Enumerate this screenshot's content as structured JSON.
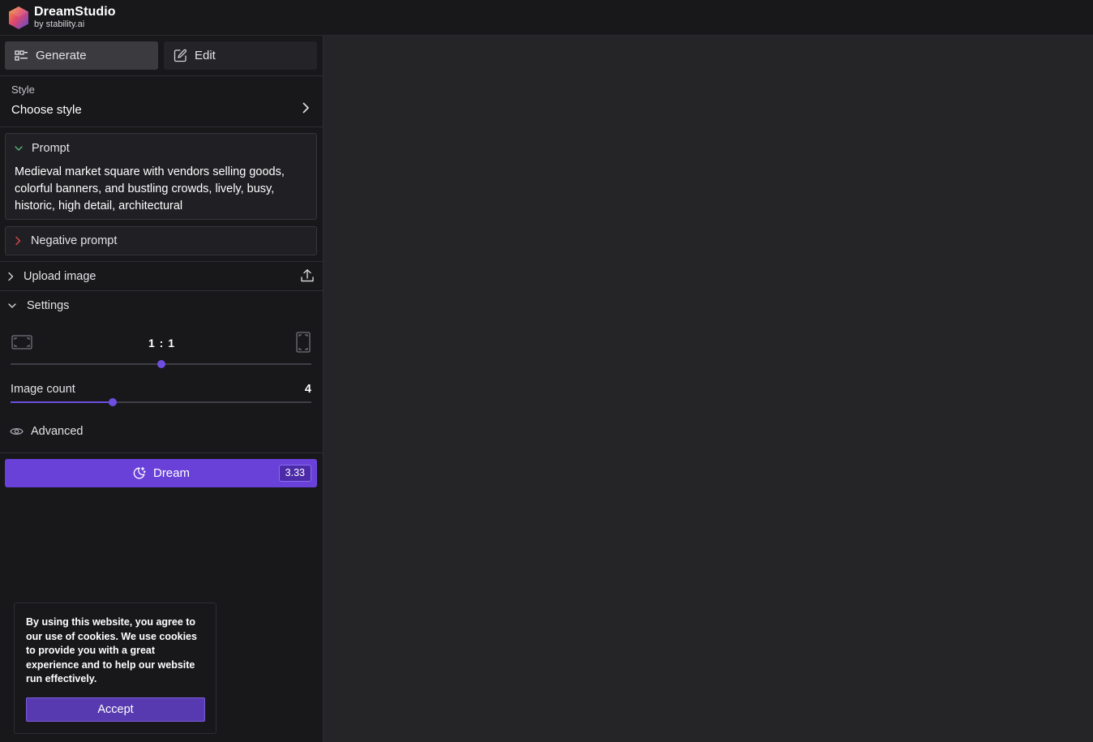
{
  "app": {
    "name": "DreamStudio",
    "subtitle": "by stability.ai"
  },
  "tabs": [
    {
      "label": "Generate",
      "icon": "grid-icon",
      "active": true
    },
    {
      "label": "Edit",
      "icon": "edit-icon",
      "active": false
    }
  ],
  "style": {
    "label": "Style",
    "value": "Choose style"
  },
  "prompt": {
    "label": "Prompt",
    "value": "Medieval market square with vendors selling goods, colorful banners, and bustling crowds, lively, busy, historic, high detail, architectural"
  },
  "negative_prompt": {
    "label": "Negative prompt"
  },
  "upload": {
    "label": "Upload image"
  },
  "settings": {
    "label": "Settings",
    "aspect_ratio": "1 : 1",
    "aspect_position": 0.5,
    "image_count_label": "Image count",
    "image_count": "4",
    "image_count_fraction": 0.34,
    "advanced_label": "Advanced"
  },
  "dream": {
    "label": "Dream",
    "cost": "3.33"
  },
  "cookie": {
    "text": "By using this website, you agree to our use of cookies. We use cookies to provide you with a great experience and to help our website run effectively.",
    "accept_label": "Accept"
  },
  "colors": {
    "accent": "#6941d8",
    "background": "#18181b",
    "canvas": "#252528"
  }
}
